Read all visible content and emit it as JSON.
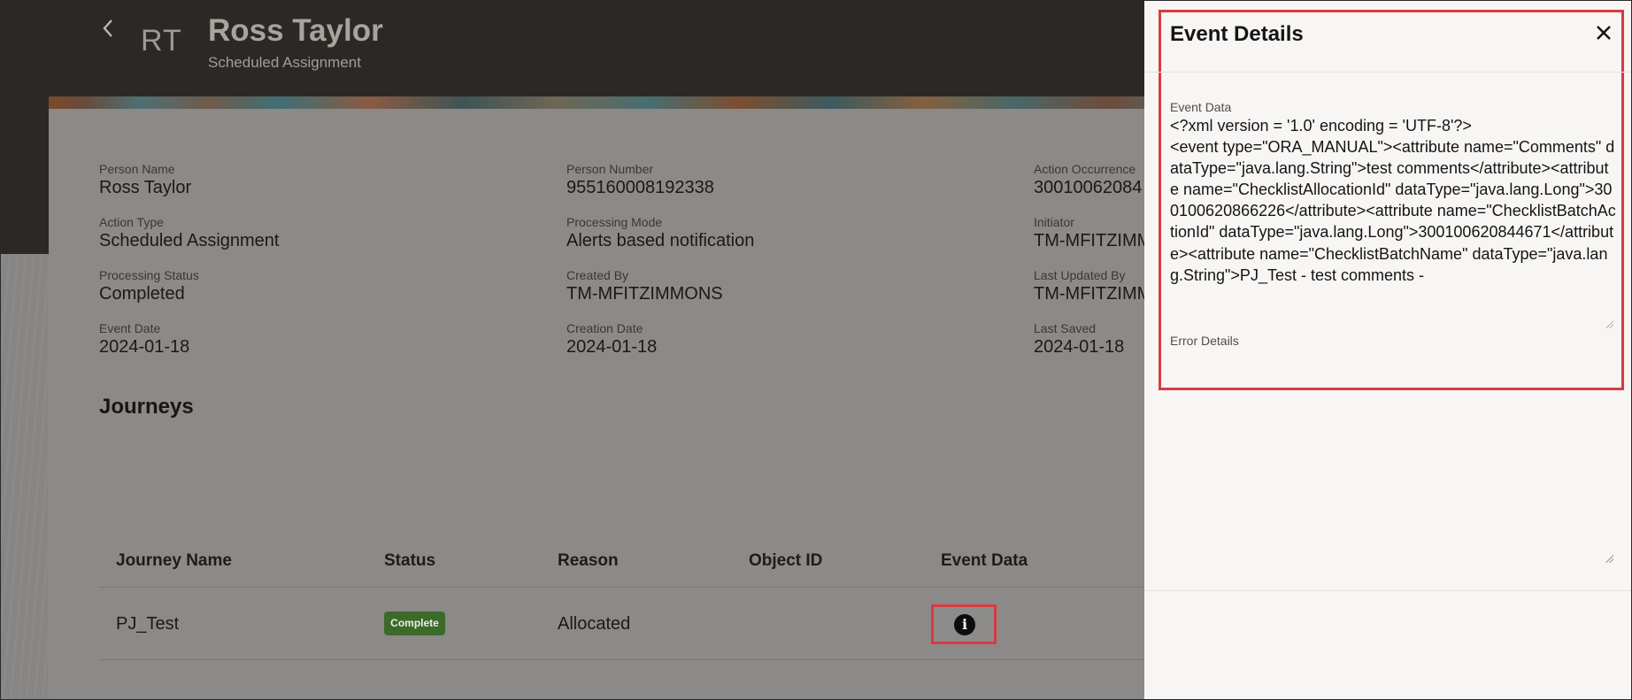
{
  "header": {
    "back_icon": "chevron-left-icon",
    "initials": "RT",
    "name": "Ross Taylor",
    "subtitle": "Scheduled Assignment"
  },
  "details": [
    {
      "label": "Person Name",
      "value": "Ross Taylor"
    },
    {
      "label": "Person Number",
      "value": "955160008192338"
    },
    {
      "label": "Action Occurrence",
      "value": "30010062084"
    },
    {
      "label": "Action Type",
      "value": "Scheduled Assignment"
    },
    {
      "label": "Processing Mode",
      "value": "Alerts based notification"
    },
    {
      "label": "Initiator",
      "value": "TM-MFITZIMM"
    },
    {
      "label": "Processing Status",
      "value": "Completed"
    },
    {
      "label": "Created By",
      "value": "TM-MFITZIMMONS"
    },
    {
      "label": "Last Updated By",
      "value": "TM-MFITZIMM"
    },
    {
      "label": "Event Date",
      "value": "2024-01-18"
    },
    {
      "label": "Creation Date",
      "value": "2024-01-18"
    },
    {
      "label": "Last Saved",
      "value": "2024-01-18"
    }
  ],
  "journeys": {
    "title": "Journeys",
    "columns": [
      "Journey Name",
      "Status",
      "Reason",
      "Object ID",
      "Event Data"
    ],
    "rows": [
      {
        "journey_name": "PJ_Test",
        "status": "Complete",
        "reason": "Allocated",
        "object_id": "",
        "event_data_icon": "info-icon"
      }
    ]
  },
  "drawer": {
    "title": "Event Details",
    "close_icon": "close-icon",
    "event_data_label": "Event Data",
    "event_data_text": "<?xml version = '1.0' encoding = 'UTF-8'?>\n<event type=\"ORA_MANUAL\"><attribute name=\"Comments\" dataType=\"java.lang.String\">test comments</attribute><attribute name=\"ChecklistAllocationId\" dataType=\"java.lang.Long\">300100620866226</attribute><attribute name=\"ChecklistBatchActionId\" dataType=\"java.lang.Long\">300100620844671</attribute><attribute name=\"ChecklistBatchName\" dataType=\"java.lang.String\">PJ_Test - test comments -",
    "error_details_label": "Error Details"
  },
  "colors": {
    "highlight": "#d93b3f",
    "badge_complete": "#3c6a2a",
    "header_bg": "#2c2826"
  }
}
